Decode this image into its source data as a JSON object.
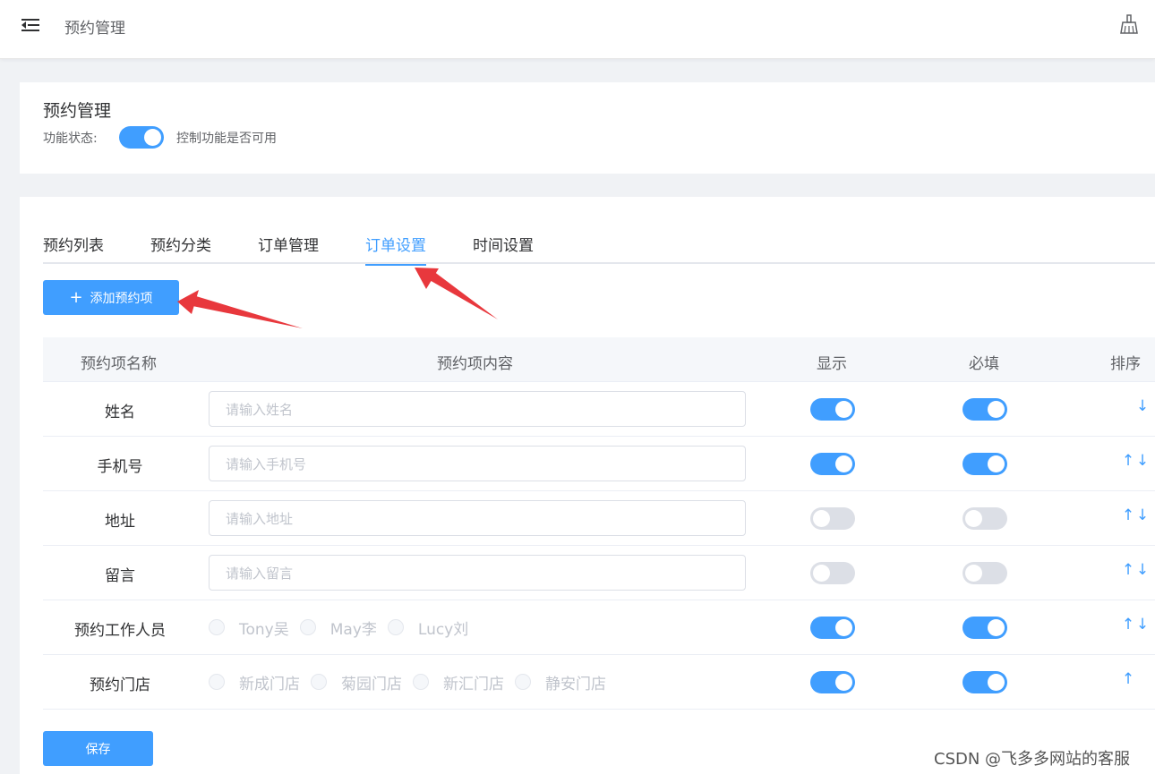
{
  "header": {
    "breadcrumb": "预约管理",
    "icons": [
      "menu-fold-icon",
      "broom-icon"
    ]
  },
  "feature_card": {
    "title": "预约管理",
    "status_label": "功能状态:",
    "status_on": true,
    "status_desc": "控制功能是否可用"
  },
  "tabs": [
    {
      "label": "预约列表",
      "active": false
    },
    {
      "label": "预约分类",
      "active": false
    },
    {
      "label": "订单管理",
      "active": false
    },
    {
      "label": "订单设置",
      "active": true
    },
    {
      "label": "时间设置",
      "active": false
    }
  ],
  "add_button": {
    "label": "添加预约项",
    "icon": "plus-icon"
  },
  "table": {
    "headers": {
      "name": "预约项名称",
      "content": "预约项内容",
      "show": "显示",
      "required": "必填",
      "sort": "排序"
    },
    "rows": [
      {
        "name": "姓名",
        "placeholder": "请输入姓名",
        "show": true,
        "required": true,
        "up": false,
        "down": true
      },
      {
        "name": "手机号",
        "placeholder": "请输入手机号",
        "show": true,
        "required": true,
        "up": true,
        "down": true
      },
      {
        "name": "地址",
        "placeholder": "请输入地址",
        "show": false,
        "required": false,
        "up": true,
        "down": true
      },
      {
        "name": "留言",
        "placeholder": "请输入留言",
        "show": false,
        "required": false,
        "up": true,
        "down": true
      },
      {
        "name": "预约工作人员",
        "options": [
          "Tony吴",
          "May李",
          "Lucy刘"
        ],
        "show": true,
        "required": true,
        "up": true,
        "down": true
      },
      {
        "name": "预约门店",
        "options": [
          "新成门店",
          "菊园门店",
          "新汇门店",
          "静安门店"
        ],
        "show": true,
        "required": true,
        "up": true,
        "down": false
      }
    ]
  },
  "save_button": {
    "label": "保存"
  },
  "sort_glyphs": {
    "up": "↑",
    "down": "↓"
  },
  "watermark": "CSDN @飞多多网站的客服",
  "colors": {
    "primary": "#409eff",
    "switch_off": "#dcdfe6",
    "annotation": "#e8383d"
  }
}
